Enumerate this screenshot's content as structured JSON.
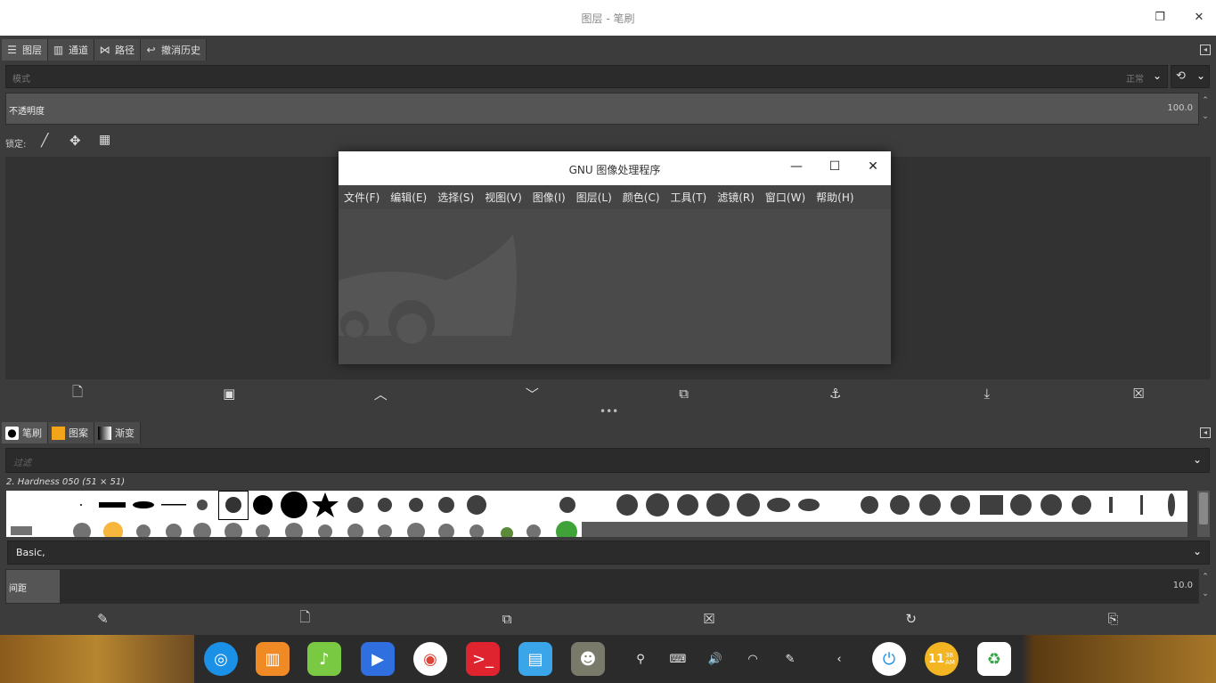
{
  "window": {
    "title": "图层 - 笔刷"
  },
  "top_tabs": [
    {
      "label": "图层",
      "icon": "layers-icon"
    },
    {
      "label": "通道",
      "icon": "channels-icon"
    },
    {
      "label": "路径",
      "icon": "paths-icon"
    },
    {
      "label": "撤消历史",
      "icon": "undo-history-icon"
    }
  ],
  "layers": {
    "mode_placeholder": "模式",
    "mode_value": "正常",
    "opacity_label": "不透明度",
    "opacity_value": "100.0",
    "lock_label": "锁定:"
  },
  "gimp_window": {
    "title": "GNU 图像处理程序",
    "menu": [
      "文件(F)",
      "编辑(E)",
      "选择(S)",
      "视图(V)",
      "图像(I)",
      "图层(L)",
      "颜色(C)",
      "工具(T)",
      "滤镜(R)",
      "窗口(W)",
      "帮助(H)"
    ]
  },
  "bottom_tabs": [
    {
      "label": "笔刷",
      "icon": "brushes-icon"
    },
    {
      "label": "图案",
      "icon": "patterns-icon"
    },
    {
      "label": "渐变",
      "icon": "gradients-icon"
    }
  ],
  "brushes": {
    "filter_placeholder": "过滤",
    "selected_brush": "2. Hardness 050 (51 × 51)",
    "tag_value": "Basic,",
    "spacing_label": "间距",
    "spacing_value": "10.0"
  },
  "taskbar": {
    "clock_hour": "11",
    "clock_min": "38",
    "clock_ampm": "AM"
  }
}
